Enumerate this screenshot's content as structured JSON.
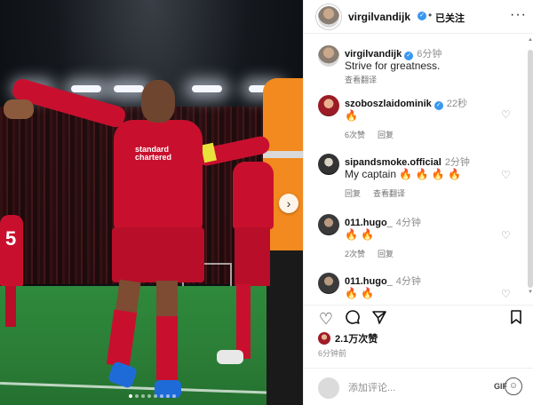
{
  "post": {
    "author": "virgilvandijk",
    "follow_status": "已关注",
    "separator": "•",
    "more": "···",
    "photo_next": "›"
  },
  "caption": {
    "username": "virgilvandijk",
    "time": "6分钟",
    "text": "Strive for greatness.",
    "translate": "查看翻译"
  },
  "comments": [
    {
      "username": "szoboszlaidominik",
      "verified": true,
      "time": "22秒",
      "text": "🔥",
      "likes": "6次赞",
      "reply": "回复"
    },
    {
      "username": "sipandsmoke.official",
      "verified": false,
      "time": "2分钟",
      "text": "My captain 🔥 🔥 🔥 🔥",
      "reply": "回复",
      "translate": "查看翻译"
    },
    {
      "username": "011.hugo_",
      "verified": false,
      "time": "4分钟",
      "text": "🔥 🔥",
      "likes": "2次赞",
      "reply": "回复"
    },
    {
      "username": "011.hugo_",
      "verified": false,
      "time": "4分钟",
      "text": "🔥 🔥"
    }
  ],
  "actions": {
    "like_count": "2.1万次赞",
    "posted_time": "6分钟前"
  },
  "add_comment": {
    "placeholder": "添加评论...",
    "gif": "GIF"
  },
  "icons": {
    "like": "heart-icon",
    "comment": "comment-icon",
    "share": "send-icon",
    "save": "bookmark-icon",
    "emoji": "emoji-icon"
  }
}
